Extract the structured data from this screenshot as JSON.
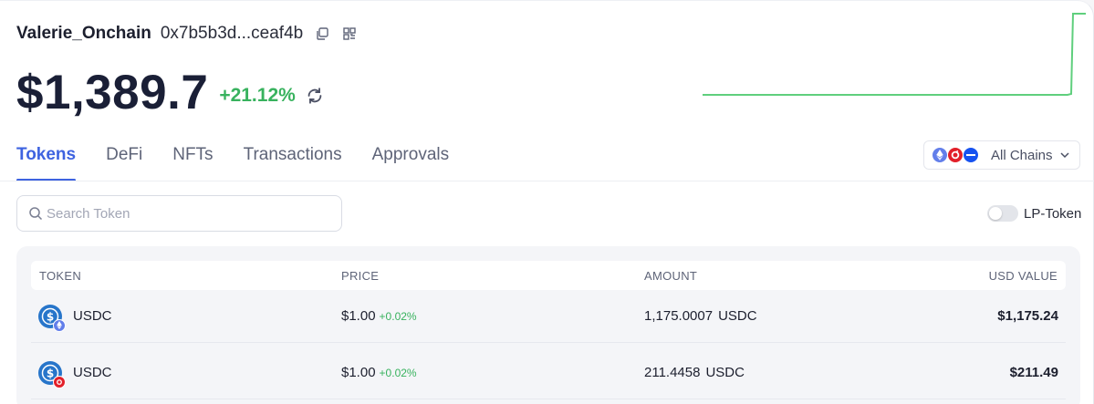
{
  "account": {
    "name": "Valerie_Onchain",
    "address": "0x7b5b3d...ceaf4b"
  },
  "balance": {
    "value": "$1,389.7",
    "change": "+21.12%"
  },
  "tabs": [
    {
      "label": "Tokens",
      "active": true
    },
    {
      "label": "DeFi",
      "active": false
    },
    {
      "label": "NFTs",
      "active": false
    },
    {
      "label": "Transactions",
      "active": false
    },
    {
      "label": "Approvals",
      "active": false
    }
  ],
  "chain_filter": {
    "label": "All Chains",
    "icons": [
      "ethereum-icon",
      "optimism-icon",
      "base-icon"
    ]
  },
  "search": {
    "placeholder": "Search Token"
  },
  "lp_toggle": {
    "label": "LP-Token",
    "on": false
  },
  "table": {
    "headers": {
      "token": "TOKEN",
      "price": "PRICE",
      "amount": "AMOUNT",
      "usd": "USD VALUE"
    },
    "rows": [
      {
        "token": "USDC",
        "chain_icon": "ethereum-icon",
        "price": "$1.00",
        "price_change": "+0.02%",
        "amount": "1,175.0007",
        "amount_symbol": "USDC",
        "usd_value": "$1,175.24"
      },
      {
        "token": "USDC",
        "chain_icon": "optimism-icon",
        "price": "$1.00",
        "price_change": "+0.02%",
        "amount": "211.4458",
        "amount_symbol": "USDC",
        "usd_value": "$211.49"
      }
    ]
  },
  "colors": {
    "accent": "#3e63e0",
    "positive": "#38b25e",
    "sparkline": "#5fcf7d",
    "usdc": "#2775ca"
  }
}
